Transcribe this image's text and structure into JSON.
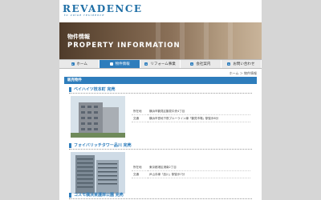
{
  "header": {
    "logo": "REVADENCE",
    "tagline": "to value residence"
  },
  "hero": {
    "title_jp": "物件情報",
    "title_en": "PROPERTY INFORMATION"
  },
  "nav": {
    "items": [
      {
        "label": "ホーム",
        "active": false
      },
      {
        "label": "物件情報",
        "active": true
      },
      {
        "label": "リフォーム事業",
        "active": false
      },
      {
        "label": "会社案内",
        "active": false
      },
      {
        "label": "お問い合わせ",
        "active": false
      }
    ]
  },
  "breadcrumb": "ホーム ＞ 物件情報",
  "section_title": "販売物件",
  "properties": [
    {
      "title": "ベイハイツ枝本町 完売",
      "rows": [
        {
          "label": "所在地",
          "value": "横浜市鶴見区鶴見中央4丁目"
        },
        {
          "label": "交通",
          "value": "横浜市営地下鉄ブルーライン線「鶴見市場」駅徒歩8分"
        }
      ]
    },
    {
      "title": "フォイバリッチタワー品川 完売",
      "rows": [
        {
          "label": "所在地",
          "value": "東京都港区港南2丁目"
        },
        {
          "label": "交通",
          "value": "JR山手線「品川」駅徒歩7分"
        }
      ]
    },
    {
      "title": "コスモ横浜東護岸公園 完売",
      "rows": []
    }
  ],
  "colors": {
    "accent": "#2e7dbc",
    "background": "#d6d6d6"
  }
}
